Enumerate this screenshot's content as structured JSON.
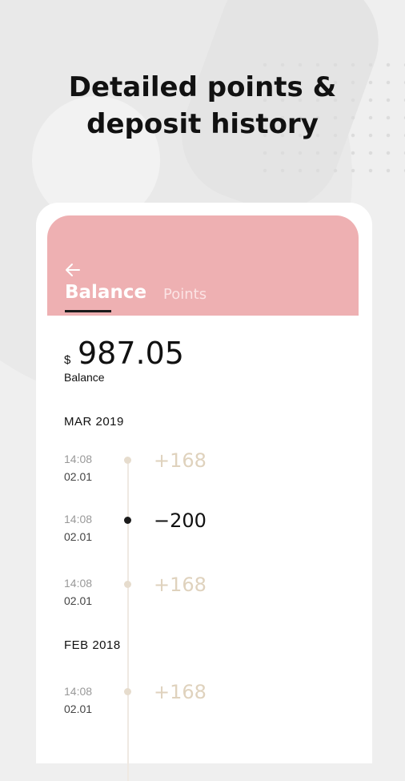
{
  "headline": {
    "line1": "Detailed points &",
    "line2": "deposit history"
  },
  "header": {
    "tabs": [
      {
        "label": "Balance",
        "active": true
      },
      {
        "label": "Points",
        "active": false
      }
    ],
    "accent_color": "#eeb0b2"
  },
  "balance": {
    "currency": "$",
    "amount": "987.05",
    "label": "Balance"
  },
  "sections": [
    {
      "month": "MAR 2019",
      "entries": [
        {
          "time": "14:08",
          "date": "02.01",
          "amount": "+168",
          "type": "credit"
        },
        {
          "time": "14:08",
          "date": "02.01",
          "amount": "−200",
          "type": "debit"
        },
        {
          "time": "14:08",
          "date": "02.01",
          "amount": "+168",
          "type": "credit"
        }
      ]
    },
    {
      "month": "FEB 2018",
      "entries": [
        {
          "time": "14:08",
          "date": "02.01",
          "amount": "+168",
          "type": "credit"
        }
      ]
    }
  ],
  "icons": {
    "back": "arrow-left-icon"
  }
}
